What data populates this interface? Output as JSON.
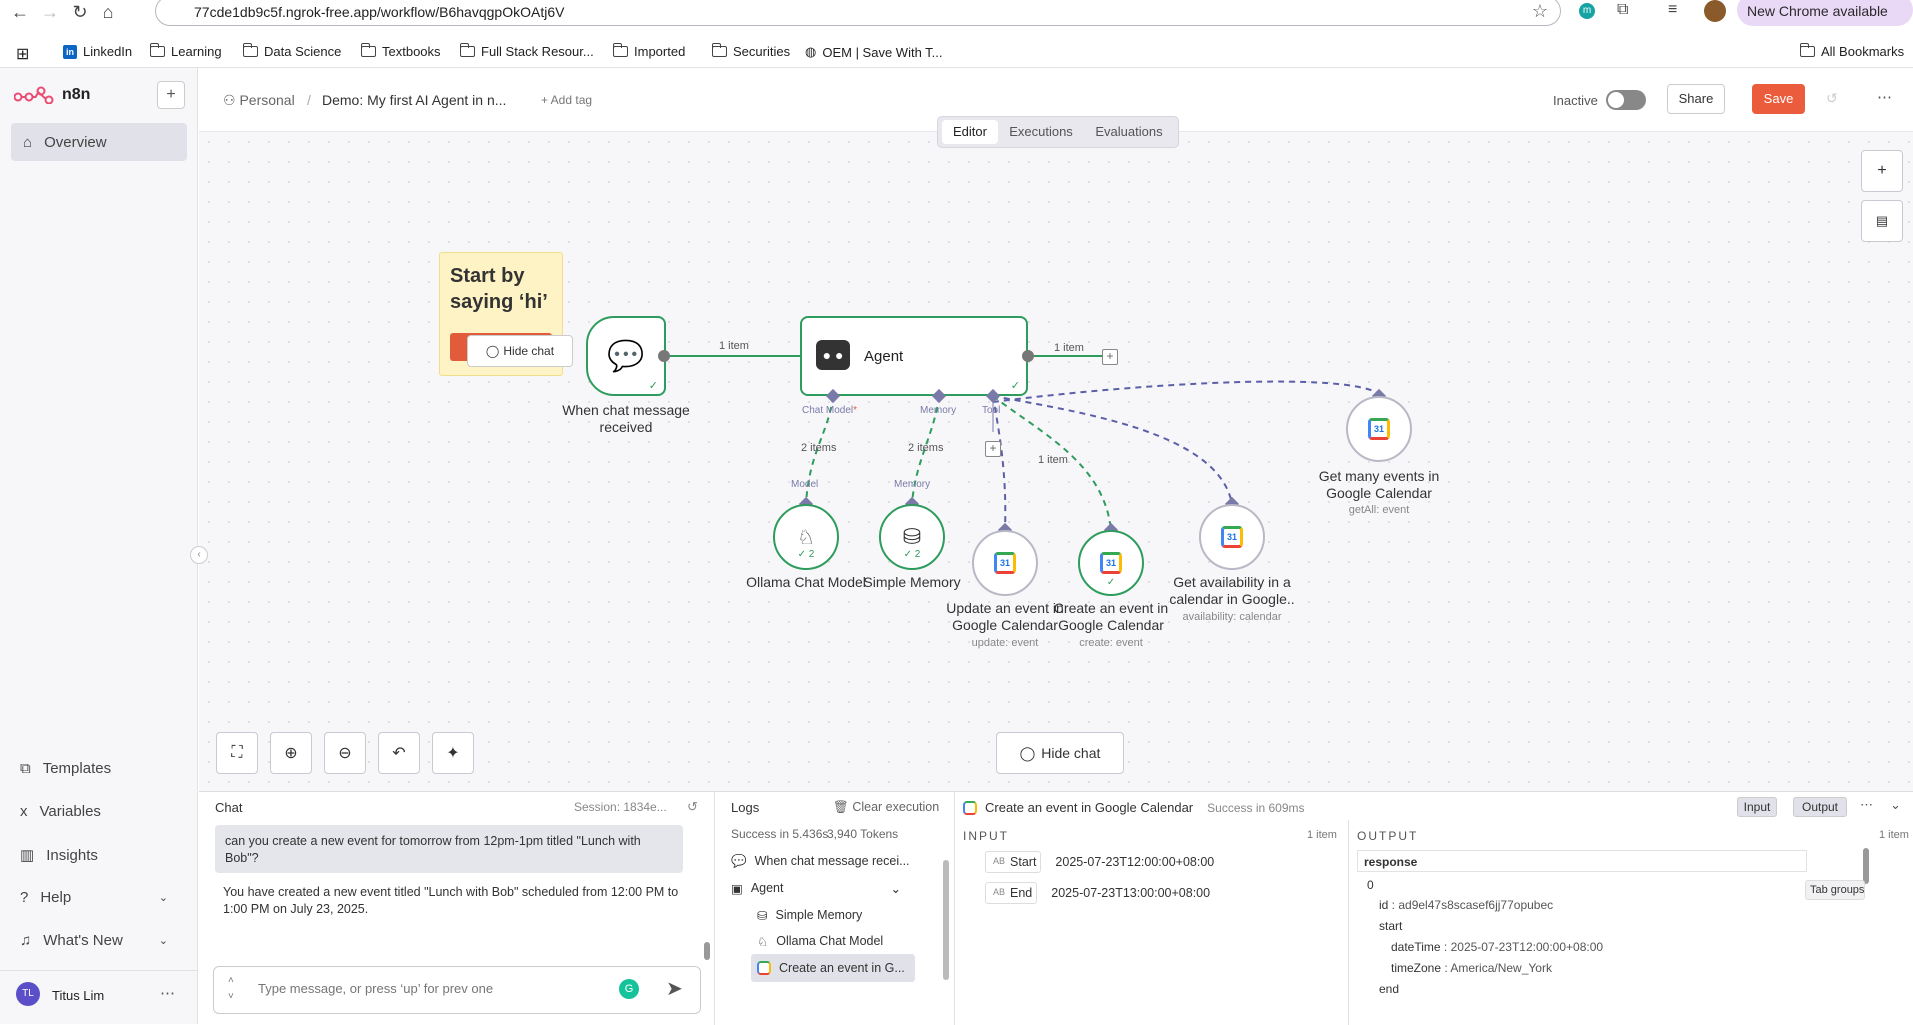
{
  "browser": {
    "url": "77cde1db9c5f.ngrok-free.app/workflow/B6havqgpOkOAtj6V",
    "chrome_update": "New Chrome available",
    "bookmarks": [
      "LinkedIn",
      "Learning",
      "Data Science",
      "Textbooks",
      "Full Stack Resour...",
      "Imported",
      "Securities",
      "OEM | Save With T...",
      "All Bookmarks"
    ],
    "tab_groups_tooltip": "Tab groups"
  },
  "sidebar": {
    "logo": "n8n",
    "add_label": "+",
    "overview": "Overview",
    "bottom_items": [
      "Templates",
      "Variables",
      "Insights",
      "Help",
      "What's New"
    ],
    "user_initials": "TL",
    "user_name": "Titus Lim"
  },
  "header": {
    "project": "Personal",
    "separator": "/",
    "workflow_name": "Demo: My first AI Agent in n...",
    "add_tag": "+ Add tag",
    "status": "Inactive",
    "share": "Share",
    "save": "Save",
    "tabs": [
      "Editor",
      "Executions",
      "Evaluations"
    ]
  },
  "canvas": {
    "sticky": {
      "text": "Start by saying ‘hi’",
      "button": "Hide chat"
    },
    "trigger": {
      "label": "When chat message received"
    },
    "agent": {
      "label": "Agent"
    },
    "edge_labels": {
      "trigger_agent": "1 item",
      "agent_out": "1 item",
      "model": "2 items",
      "memory": "2 items",
      "tool": "1 item"
    },
    "ports": {
      "chat_model": "Chat Model",
      "memory": "Memory",
      "tool": "Tool",
      "model_in": "Model",
      "memory_in": "Memory"
    },
    "sub_nodes": {
      "ollama": {
        "label": "Ollama Chat Model",
        "badge": "✓ 2"
      },
      "memory": {
        "label": "Simple Memory",
        "badge": "✓ 2"
      },
      "update": {
        "label": "Update an event in Google Calendar",
        "sub": "update: event"
      },
      "create": {
        "label": "Create an event in Google Calendar",
        "sub": "create: event"
      },
      "availability": {
        "label": "Get availability in a calendar in Google..",
        "sub": "availability: calendar"
      },
      "getmany": {
        "label": "Get many events in Google Calendar",
        "sub": "getAll: event"
      }
    },
    "hide_chat": "Hide chat"
  },
  "chat": {
    "title": "Chat",
    "session": "Session: 1834e...",
    "user_msg": "can you create a new event for tomorrow from 12pm-1pm titled \"Lunch with Bob\"?",
    "bot_msg": "You have created a new event titled \"Lunch with Bob\" scheduled from 12:00 PM to 1:00 PM on July 23, 2025.",
    "input_placeholder": "Type message, or press ‘up’ for prev one"
  },
  "logs": {
    "title": "Logs",
    "clear": "Clear execution",
    "summary": "Success in 5.436s",
    "tokens": "3,940 Tokens",
    "items": [
      "When chat message recei...",
      "Agent",
      "Simple Memory",
      "Ollama Chat Model",
      "Create an event in G..."
    ]
  },
  "detail": {
    "title": "Create an event in Google Calendar",
    "status": "Success in 609ms",
    "input_btn": "Input",
    "output_btn": "Output",
    "input_label": "INPUT",
    "input_count": "1 item",
    "input_rows": [
      {
        "tag": "AB",
        "key": "Start",
        "value": "2025-07-23T12:00:00+08:00"
      },
      {
        "tag": "AB",
        "key": "End",
        "value": "2025-07-23T13:00:00+08:00"
      }
    ],
    "output_label": "OUTPUT",
    "output_count": "1 item",
    "response_header": "response",
    "index": "0",
    "id_key": "id",
    "id_value": "ad9el47s8scasef6jj77opubec",
    "start_key": "start",
    "datetime_key": "dateTime",
    "datetime_value": "2025-07-23T12:00:00+08:00",
    "timezone_key": "timeZone",
    "timezone_value": "America/New_York",
    "end_key": "end"
  },
  "colors": {
    "accent": "#ea5c3b",
    "success": "#2e9c5c",
    "tool_edge": "#5b5fa8"
  }
}
